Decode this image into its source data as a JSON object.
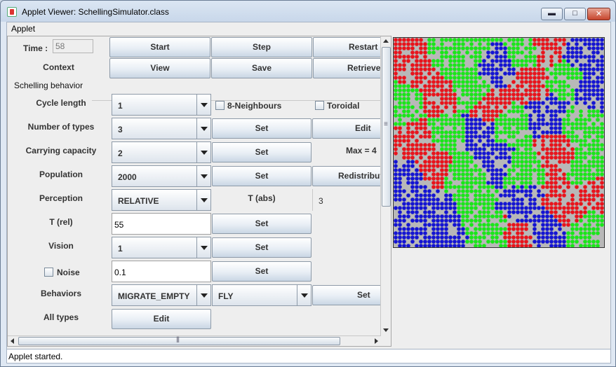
{
  "window": {
    "title": "Applet Viewer: SchellingSimulator.class",
    "controls": {
      "minimize": "▬",
      "maximize": "□",
      "close": "✕"
    }
  },
  "menubar": {
    "applet_menu": "Applet"
  },
  "controls": {
    "time_label": "Time :",
    "time_value": "58",
    "start": "Start",
    "step": "Step",
    "restart": "Restart",
    "context_label": "Context",
    "view": "View",
    "save": "Save",
    "retrieve": "Retrieve"
  },
  "schelling": {
    "section_title": "Schelling behavior",
    "cycle_length": {
      "label": "Cycle length",
      "value": "1"
    },
    "eight_neighbours": {
      "label": "8-Neighbours",
      "checked": false
    },
    "toroidal": {
      "label": "Toroidal",
      "checked": false
    },
    "number_of_types": {
      "label": "Number of types",
      "value": "3",
      "set": "Set",
      "edit": "Edit"
    },
    "carrying_capacity": {
      "label": "Carrying capacity",
      "value": "2",
      "set": "Set",
      "max": "Max = 4"
    },
    "population": {
      "label": "Population",
      "value": "2000",
      "set": "Set",
      "redistribute": "Redistribut"
    },
    "perception": {
      "label": "Perception",
      "value": "RELATIVE",
      "t_abs_label": "T (abs)",
      "t_abs_value": "3"
    },
    "t_rel": {
      "label": "T (rel)",
      "value": "55",
      "set": "Set"
    },
    "vision": {
      "label": "Vision",
      "value": "1",
      "set": "Set"
    },
    "noise": {
      "label": "Noise",
      "checked": false,
      "value": "0.1",
      "set": "Set"
    },
    "behaviors": {
      "label": "Behaviors",
      "migrate": "MIGRATE_EMPTY",
      "mode": "FLY",
      "set": "Set"
    },
    "all_types": {
      "label": "All types",
      "edit": "Edit"
    }
  },
  "simulation_grid": {
    "colors": {
      "empty": "#b8b8b8",
      "red": "#e8131b",
      "green": "#19e619",
      "blue": "#1414d2"
    }
  },
  "status": {
    "text": "Applet started."
  }
}
